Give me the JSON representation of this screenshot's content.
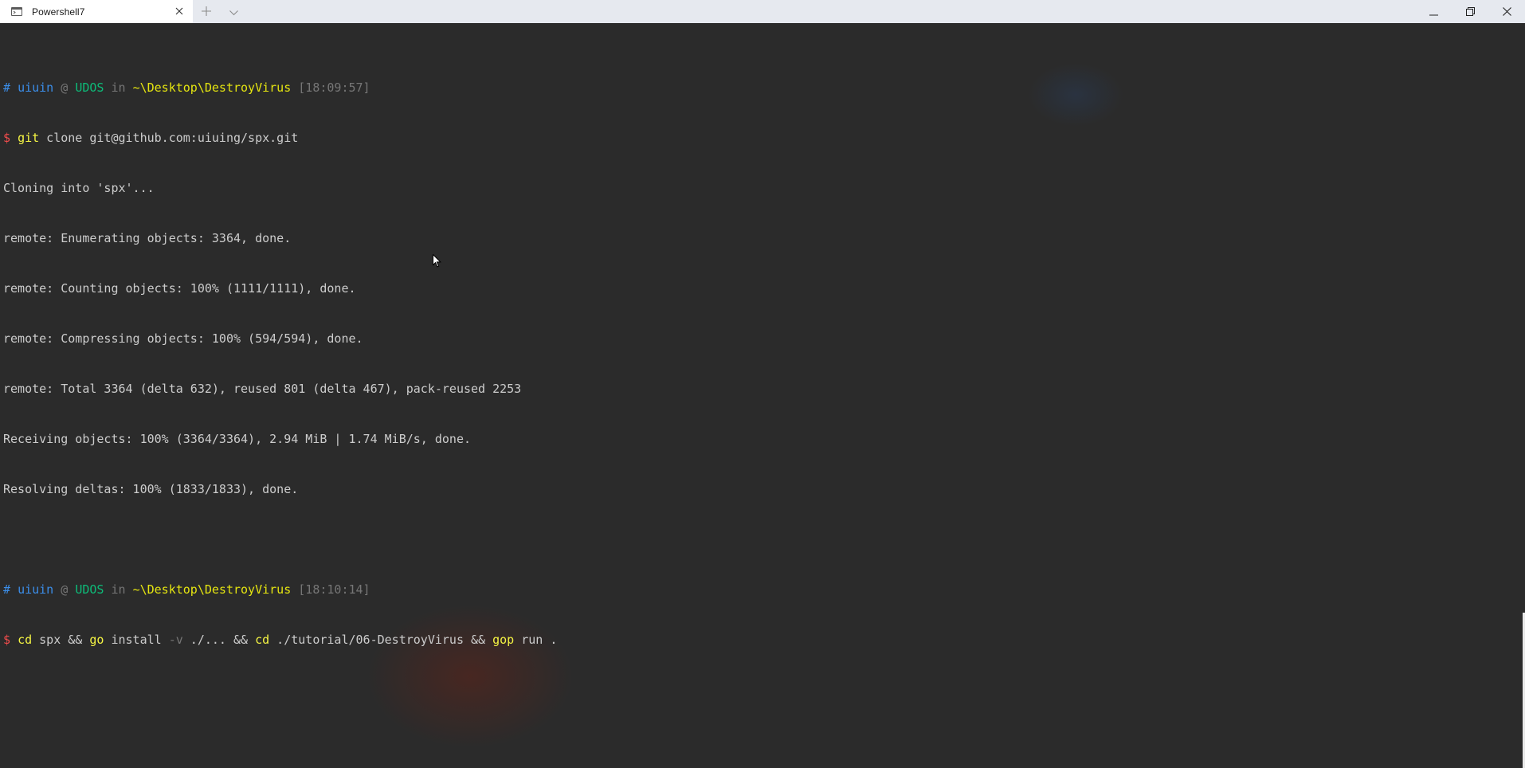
{
  "tab": {
    "title": "Powershell7",
    "icon": "terminal-icon"
  },
  "titlebar": {
    "new_tab_icon": "plus-icon",
    "dropdown_icon": "chevron-down-icon",
    "minimize_icon": "minimize-icon",
    "maximize_icon": "restore-icon",
    "close_icon": "close-icon"
  },
  "prompt1": {
    "hash": "#",
    "user": "uiuin",
    "at": "@",
    "host": "UDOS",
    "in": "in",
    "path": "~\\Desktop\\DestroyVirus",
    "time": "[18:09:57]",
    "dollar": "$",
    "cmd": "git",
    "args": " clone git@github.com:uiuing/spx.git"
  },
  "output": [
    "Cloning into 'spx'...",
    "remote: Enumerating objects: 3364, done.",
    "remote: Counting objects: 100% (1111/1111), done.",
    "remote: Compressing objects: 100% (594/594), done.",
    "remote: Total 3364 (delta 632), reused 801 (delta 467), pack-reused 2253",
    "Receiving objects: 100% (3364/3364), 2.94 MiB | 1.74 MiB/s, done.",
    "Resolving deltas: 100% (1833/1833), done."
  ],
  "prompt2": {
    "hash": "#",
    "user": "uiuin",
    "at": "@",
    "host": "UDOS",
    "in": "in",
    "path": "~\\Desktop\\DestroyVirus",
    "time": "[18:10:14]",
    "dollar": "$",
    "cmd1": "cd",
    "arg1": " spx && ",
    "cmd2": "go",
    "arg2": " install ",
    "flag": "-v",
    "arg3": " ./... && ",
    "cmd3": "cd",
    "arg4": " ./tutorial/06-DestroyVirus && ",
    "cmd4": "gop",
    "arg5": " run ."
  },
  "colors": {
    "background": "#2b2b2b",
    "user": "#3b8eea",
    "host": "#0dbc79",
    "path": "#e5e510",
    "dollar": "#f14c4c",
    "command": "#f5f543",
    "dim": "#767676",
    "text": "#cccccc"
  }
}
